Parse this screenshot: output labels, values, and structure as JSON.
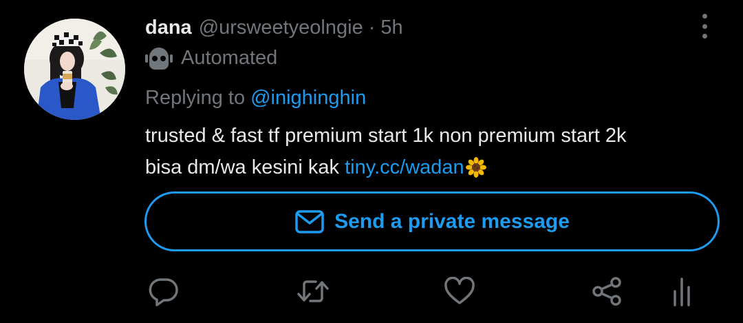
{
  "tweet": {
    "display_name": "dana",
    "handle": "@ursweetyeolngie",
    "separator": "·",
    "time": "5h",
    "automated_label": "Automated",
    "replying_prefix": "Replying to",
    "replying_to": "@inighinghin",
    "text_line1": "trusted & fast tf premium start 1k non premium start 2k",
    "text_line2_prefix": "bisa dm/wa kesini kak ",
    "text_link": "tiny.cc/wadan",
    "emoji": "sunflower-emoji"
  },
  "dm_button": {
    "label": "Send a private message",
    "icon": "envelope-icon"
  },
  "actions": [
    {
      "name": "reply",
      "icon": "reply-icon"
    },
    {
      "name": "retweet",
      "icon": "retweet-icon"
    },
    {
      "name": "like",
      "icon": "heart-icon"
    },
    {
      "name": "share",
      "icon": "share-icon"
    },
    {
      "name": "analytics",
      "icon": "analytics-icon"
    }
  ],
  "colors": {
    "background": "#000000",
    "text_primary": "#e7e9ea",
    "text_secondary": "#71767b",
    "accent": "#1d9bf0"
  }
}
